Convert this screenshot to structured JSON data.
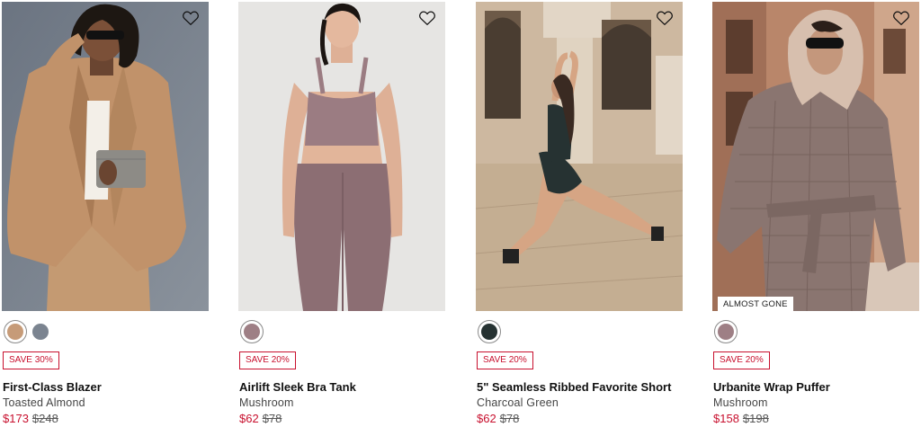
{
  "products": [
    {
      "name": "First-Class Blazer",
      "color": "Toasted Almond",
      "sale_price": "$173",
      "original_price": "$248",
      "badge": "SAVE 30%",
      "stock_tag": "",
      "swatches": [
        {
          "color_hex": "#c69b78",
          "selected": true
        },
        {
          "color_hex": "#7b8490",
          "selected": false
        }
      ]
    },
    {
      "name": "Airlift Sleek Bra Tank",
      "color": "Mushroom",
      "sale_price": "$62",
      "original_price": "$78",
      "badge": "SAVE 20%",
      "stock_tag": "",
      "swatches": [
        {
          "color_hex": "#9e7f85",
          "selected": true
        }
      ]
    },
    {
      "name": "5\" Seamless Ribbed Favorite Short",
      "color": "Charcoal Green",
      "sale_price": "$62",
      "original_price": "$78",
      "badge": "SAVE 20%",
      "stock_tag": "",
      "swatches": [
        {
          "color_hex": "#263232",
          "selected": true
        }
      ]
    },
    {
      "name": "Urbanite Wrap Puffer",
      "color": "Mushroom",
      "sale_price": "$158",
      "original_price": "$198",
      "badge": "SAVE 20%",
      "stock_tag": "ALMOST GONE",
      "swatches": [
        {
          "color_hex": "#9e7f85",
          "selected": true
        }
      ]
    }
  ],
  "icons": {
    "wishlist": "heart-outline-icon"
  },
  "colors": {
    "sale_red": "#c8102e",
    "text_dark": "#111111",
    "text_muted": "#444444"
  }
}
